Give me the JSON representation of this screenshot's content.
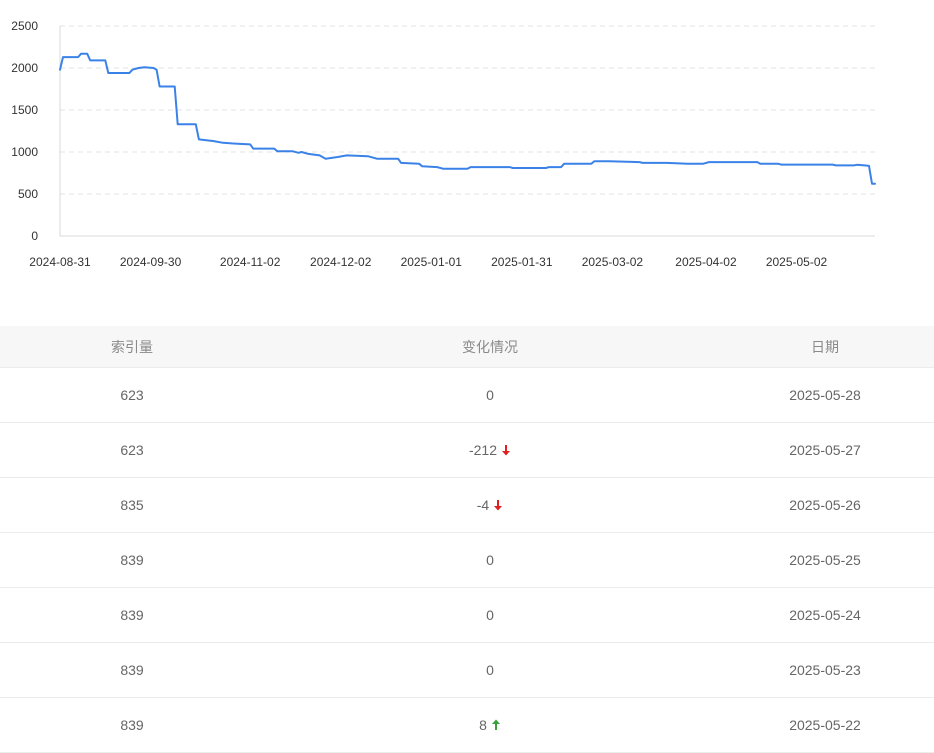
{
  "colors": {
    "line": "#3b82e8",
    "down": "#e02020",
    "up": "#3aa03a"
  },
  "chart_data": {
    "type": "line",
    "x_tick_labels": [
      "2024-08-31",
      "2024-09-30",
      "2024-11-02",
      "2024-12-02",
      "2025-01-01",
      "2025-01-31",
      "2025-03-02",
      "2025-04-02",
      "2025-05-02"
    ],
    "y_tick_labels": [
      "0",
      "500",
      "1000",
      "1500",
      "2000",
      "2500"
    ],
    "ylim": [
      0,
      2500
    ],
    "xlim": [
      "2024-08-31",
      "2025-05-28"
    ],
    "grid": true,
    "series": [
      {
        "points": [
          [
            "2024-08-31",
            1980
          ],
          [
            "2024-09-01",
            2130
          ],
          [
            "2024-09-06",
            2130
          ],
          [
            "2024-09-07",
            2170
          ],
          [
            "2024-09-09",
            2170
          ],
          [
            "2024-09-10",
            2090
          ],
          [
            "2024-09-15",
            2090
          ],
          [
            "2024-09-16",
            1940
          ],
          [
            "2024-09-23",
            1940
          ],
          [
            "2024-09-24",
            1980
          ],
          [
            "2024-09-26",
            2000
          ],
          [
            "2024-09-28",
            2010
          ],
          [
            "2024-10-01",
            2000
          ],
          [
            "2024-10-02",
            1980
          ],
          [
            "2024-10-03",
            1780
          ],
          [
            "2024-10-08",
            1780
          ],
          [
            "2024-10-09",
            1330
          ],
          [
            "2024-10-15",
            1330
          ],
          [
            "2024-10-16",
            1150
          ],
          [
            "2024-10-21",
            1130
          ],
          [
            "2024-10-24",
            1110
          ],
          [
            "2024-10-28",
            1100
          ],
          [
            "2024-11-02",
            1090
          ],
          [
            "2024-11-03",
            1040
          ],
          [
            "2024-11-10",
            1040
          ],
          [
            "2024-11-11",
            1010
          ],
          [
            "2024-11-16",
            1010
          ],
          [
            "2024-11-18",
            990
          ],
          [
            "2024-11-19",
            1000
          ],
          [
            "2024-11-21",
            980
          ],
          [
            "2024-11-25",
            960
          ],
          [
            "2024-11-27",
            920
          ],
          [
            "2024-12-01",
            940
          ],
          [
            "2024-12-04",
            960
          ],
          [
            "2024-12-11",
            950
          ],
          [
            "2024-12-14",
            920
          ],
          [
            "2024-12-21",
            920
          ],
          [
            "2024-12-22",
            870
          ],
          [
            "2024-12-28",
            860
          ],
          [
            "2024-12-29",
            830
          ],
          [
            "2025-01-03",
            820
          ],
          [
            "2025-01-05",
            800
          ],
          [
            "2025-01-13",
            800
          ],
          [
            "2025-01-14",
            820
          ],
          [
            "2025-01-27",
            820
          ],
          [
            "2025-01-28",
            810
          ],
          [
            "2025-02-08",
            810
          ],
          [
            "2025-02-09",
            820
          ],
          [
            "2025-02-13",
            820
          ],
          [
            "2025-02-14",
            860
          ],
          [
            "2025-02-23",
            860
          ],
          [
            "2025-02-24",
            890
          ],
          [
            "2025-03-01",
            890
          ],
          [
            "2025-03-11",
            880
          ],
          [
            "2025-03-12",
            870
          ],
          [
            "2025-03-20",
            870
          ],
          [
            "2025-03-27",
            860
          ],
          [
            "2025-04-01",
            860
          ],
          [
            "2025-04-03",
            880
          ],
          [
            "2025-04-12",
            880
          ],
          [
            "2025-04-19",
            880
          ],
          [
            "2025-04-20",
            860
          ],
          [
            "2025-04-26",
            860
          ],
          [
            "2025-04-27",
            850
          ],
          [
            "2025-05-14",
            850
          ],
          [
            "2025-05-15",
            840
          ],
          [
            "2025-05-21",
            840
          ],
          [
            "2025-05-22",
            848
          ],
          [
            "2025-05-25",
            839
          ],
          [
            "2025-05-26",
            835
          ],
          [
            "2025-05-27",
            623
          ],
          [
            "2025-05-28",
            623
          ]
        ]
      }
    ]
  },
  "table": {
    "headers": [
      "索引量",
      "变化情况",
      "日期"
    ],
    "rows": [
      {
        "count": "623",
        "change": "0",
        "dir": "none",
        "date": "2025-05-28"
      },
      {
        "count": "623",
        "change": "-212",
        "dir": "down",
        "date": "2025-05-27"
      },
      {
        "count": "835",
        "change": "-4",
        "dir": "down",
        "date": "2025-05-26"
      },
      {
        "count": "839",
        "change": "0",
        "dir": "none",
        "date": "2025-05-25"
      },
      {
        "count": "839",
        "change": "0",
        "dir": "none",
        "date": "2025-05-24"
      },
      {
        "count": "839",
        "change": "0",
        "dir": "none",
        "date": "2025-05-23"
      },
      {
        "count": "839",
        "change": "8",
        "dir": "up",
        "date": "2025-05-22"
      }
    ]
  }
}
